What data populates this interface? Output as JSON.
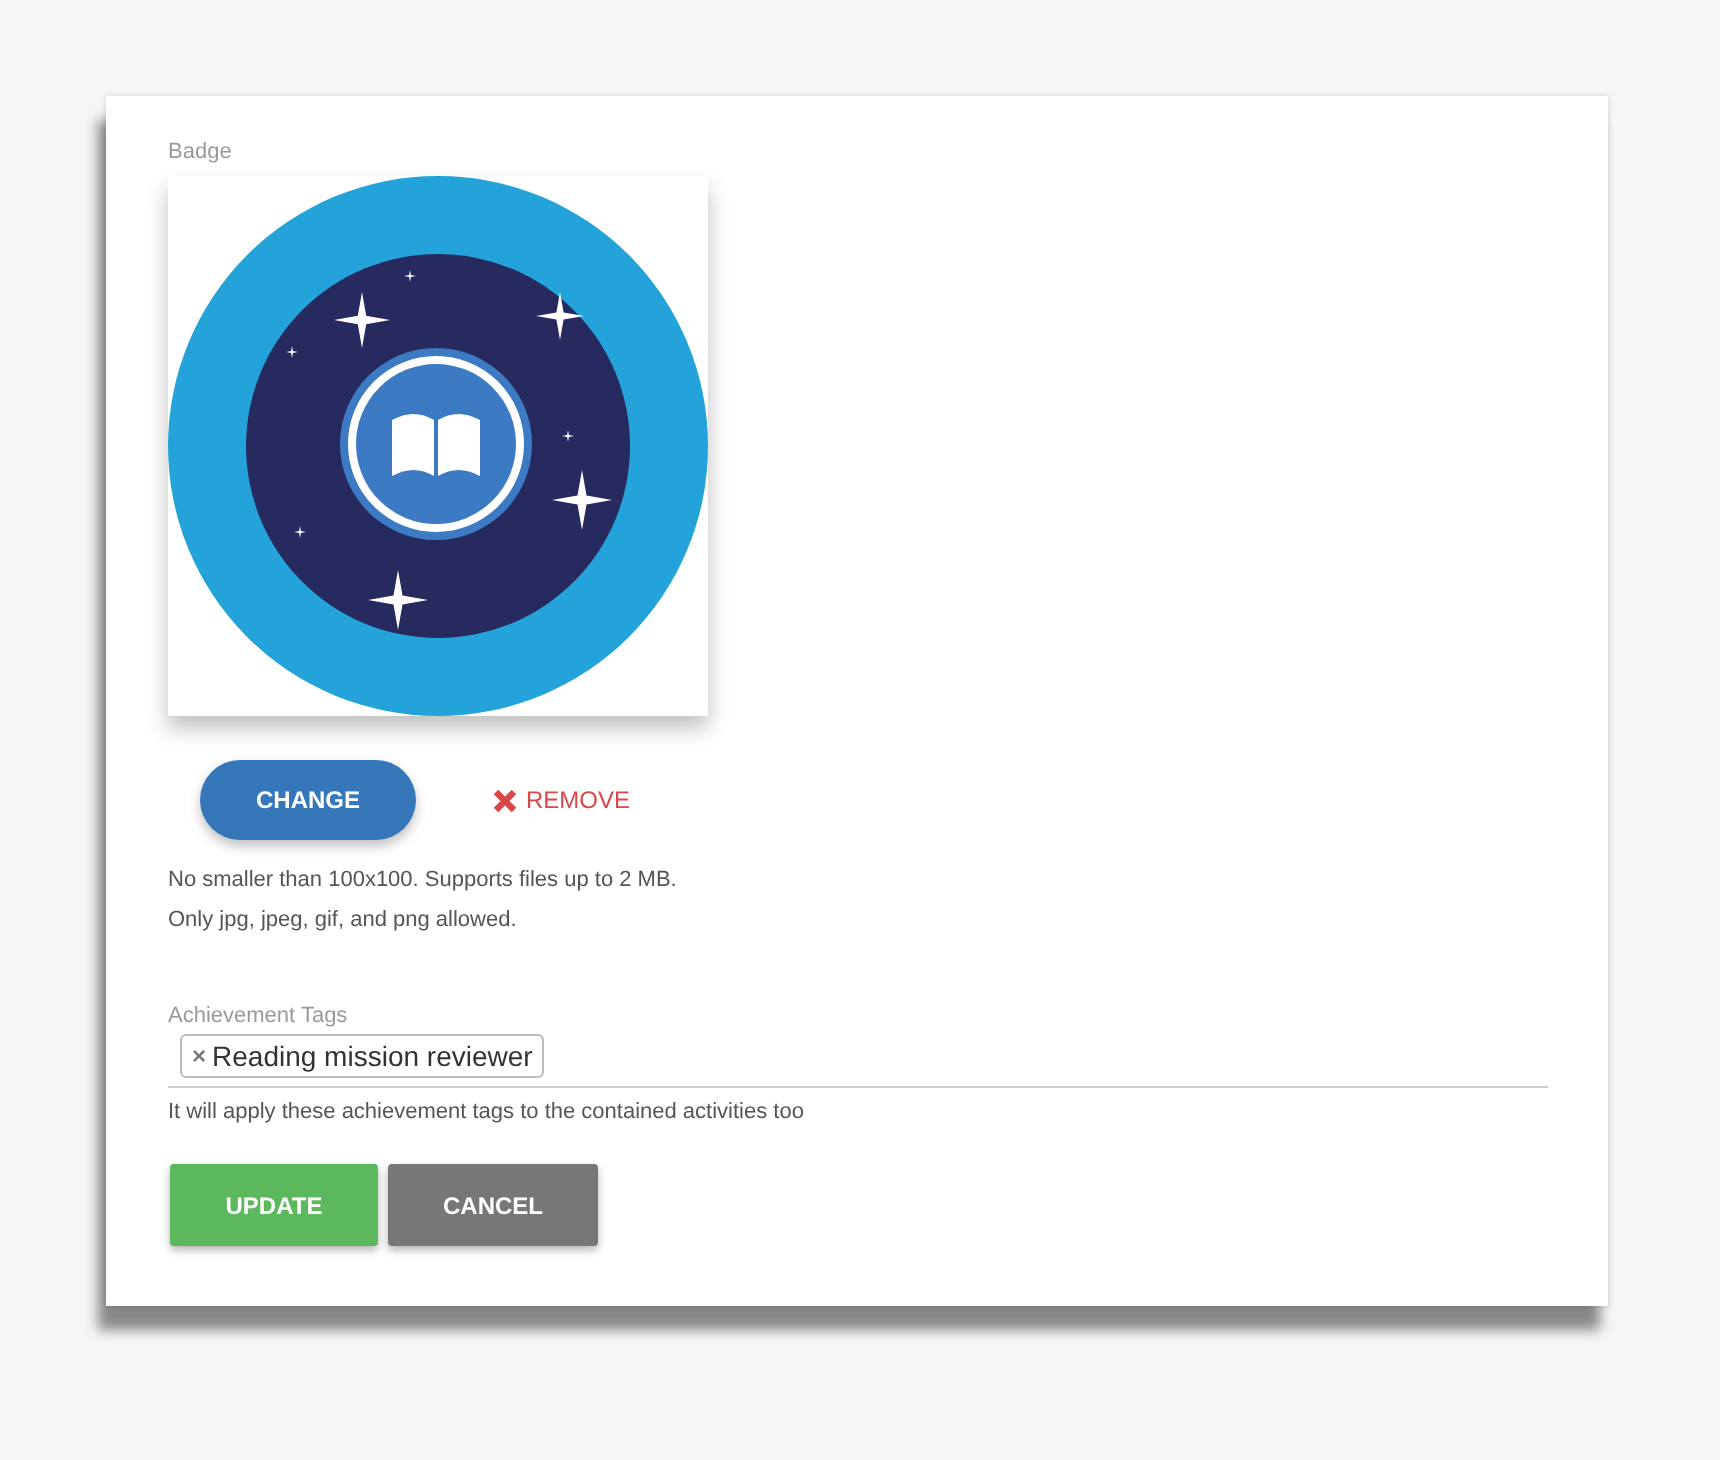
{
  "badge": {
    "label": "Badge",
    "change_button": "CHANGE",
    "remove_button": "REMOVE",
    "hints": [
      "No smaller than 100x100. Supports files up to 2 MB.",
      "Only jpg, jpeg, gif, and png allowed."
    ]
  },
  "achievement_tags": {
    "label": "Achievement Tags",
    "tags": [
      {
        "remove": "×",
        "text": "Reading mission reviewer"
      }
    ],
    "helper": "It will apply these achievement tags to the contained activities too"
  },
  "buttons": [
    {
      "kind": "primary",
      "label": "UPDATE"
    },
    {
      "kind": "secondary",
      "label": "CANCEL"
    }
  ]
}
